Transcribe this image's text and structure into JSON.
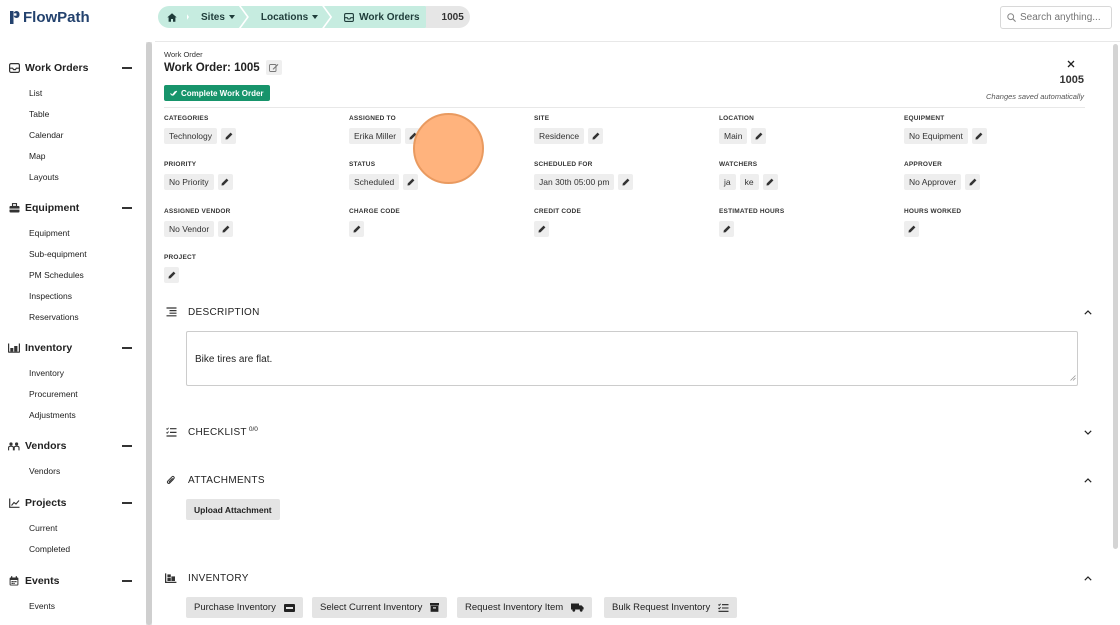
{
  "app": {
    "name": "FlowPath"
  },
  "sidebar": {
    "sections": [
      {
        "label": "Work Orders",
        "items": [
          "List",
          "Table",
          "Calendar",
          "Map",
          "Layouts"
        ]
      },
      {
        "label": "Equipment",
        "items": [
          "Equipment",
          "Sub-equipment",
          "PM Schedules",
          "Inspections",
          "Reservations"
        ]
      },
      {
        "label": "Inventory",
        "items": [
          "Inventory",
          "Procurement",
          "Adjustments"
        ]
      },
      {
        "label": "Vendors",
        "items": [
          "Vendors"
        ]
      },
      {
        "label": "Projects",
        "items": [
          "Current",
          "Completed"
        ]
      },
      {
        "label": "Events",
        "items": [
          "Events"
        ]
      }
    ]
  },
  "breadcrumb": {
    "sites": "Sites",
    "locations": "Locations",
    "work_orders": "Work Orders",
    "current": "1005"
  },
  "search": {
    "placeholder": "Search anything..."
  },
  "header": {
    "subtitle": "Work Order",
    "title": "Work Order: 1005",
    "complete_button": "Complete Work Order",
    "number": "1005",
    "saved_status": "Changes saved automatically"
  },
  "fields": {
    "categories": {
      "label": "CATEGORIES",
      "value": "Technology"
    },
    "assigned_to": {
      "label": "ASSIGNED TO",
      "value": "Erika Miller"
    },
    "site": {
      "label": "SITE",
      "value": "Residence"
    },
    "location": {
      "label": "LOCATION",
      "value": "Main"
    },
    "equipment": {
      "label": "EQUIPMENT",
      "value": "No Equipment"
    },
    "priority": {
      "label": "PRIORITY",
      "value": "No Priority"
    },
    "status": {
      "label": "STATUS",
      "value": "Scheduled"
    },
    "scheduled_for": {
      "label": "SCHEDULED FOR",
      "value": "Jan 30th 05:00 pm"
    },
    "watchers": {
      "label": "WATCHERS",
      "values": [
        "ja",
        "ke"
      ]
    },
    "approver": {
      "label": "APPROVER",
      "value": "No Approver"
    },
    "assigned_vendor": {
      "label": "ASSIGNED VENDOR",
      "value": "No Vendor"
    },
    "charge_code": {
      "label": "CHARGE CODE"
    },
    "credit_code": {
      "label": "CREDIT CODE"
    },
    "estimated_hours": {
      "label": "ESTIMATED HOURS"
    },
    "hours_worked": {
      "label": "HOURS WORKED"
    },
    "project": {
      "label": "PROJECT"
    }
  },
  "description": {
    "title": "DESCRIPTION",
    "text": "Bike tires are flat."
  },
  "checklist": {
    "title": "CHECKLIST",
    "count": "0/0"
  },
  "attachments": {
    "title": "ATTACHMENTS",
    "upload_button": "Upload Attachment"
  },
  "inventory": {
    "title": "INVENTORY",
    "buttons": [
      "Purchase Inventory",
      "Select Current Inventory",
      "Request Inventory Item",
      "Bulk Request Inventory"
    ]
  },
  "colors": {
    "brand": "#23426e",
    "accent_green": "#17946b",
    "breadcrumb_bg": "#c6ece0",
    "cursor_highlight": "#ffab70"
  }
}
